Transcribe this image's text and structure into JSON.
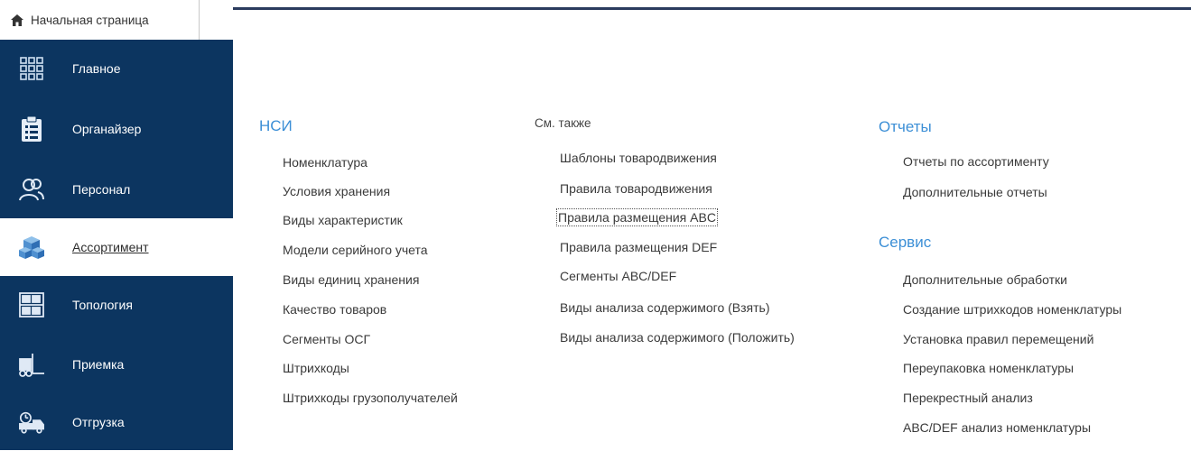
{
  "home_tab": {
    "label": "Начальная страница",
    "icon": "home-icon"
  },
  "sidebar": {
    "items": [
      {
        "label": "Главное",
        "icon": "grid-icon",
        "active": false
      },
      {
        "label": "Органайзер",
        "icon": "clipboard-icon",
        "active": false
      },
      {
        "label": "Персонал",
        "icon": "people-icon",
        "active": false
      },
      {
        "label": "Ассортимент",
        "icon": "boxes-icon",
        "active": true
      },
      {
        "label": "Топология",
        "icon": "shelves-icon",
        "active": false
      },
      {
        "label": "Приемка",
        "icon": "forklift-icon",
        "active": false
      },
      {
        "label": "Отгрузка",
        "icon": "truck-icon",
        "active": false
      }
    ]
  },
  "nsi": {
    "title": "НСИ",
    "links": [
      "Номенклатура",
      "Условия хранения",
      "Виды характеристик",
      "Модели серийного учета",
      "Виды единиц хранения",
      "Качество товаров",
      "Сегменты ОСГ",
      "Штрихкоды",
      "Штрихкоды грузополучателей"
    ]
  },
  "see_also": {
    "title": "См. также",
    "links": [
      "Шаблоны товародвижения",
      "Правила товародвижения",
      "Правила размещения ABC",
      "Правила размещения DEF",
      "Сегменты ABC/DEF",
      "Виды анализа содержимого (Взять)",
      "Виды анализа содержимого (Положить)"
    ]
  },
  "reports": {
    "title": "Отчеты",
    "links": [
      "Отчеты по ассортименту",
      "Дополнительные отчеты"
    ]
  },
  "service": {
    "title": "Сервис",
    "links": [
      "Дополнительные обработки",
      "Создание штрихкодов номенклатуры",
      "Установка правил перемещений",
      "Переупаковка номенклатуры",
      "Перекрестный анализ",
      "ABC/DEF анализ номенклатуры"
    ]
  },
  "colors": {
    "sidebar_bg": "#0c3560",
    "section_title": "#3c8fd6",
    "active_item_bg": "#ffffff"
  }
}
